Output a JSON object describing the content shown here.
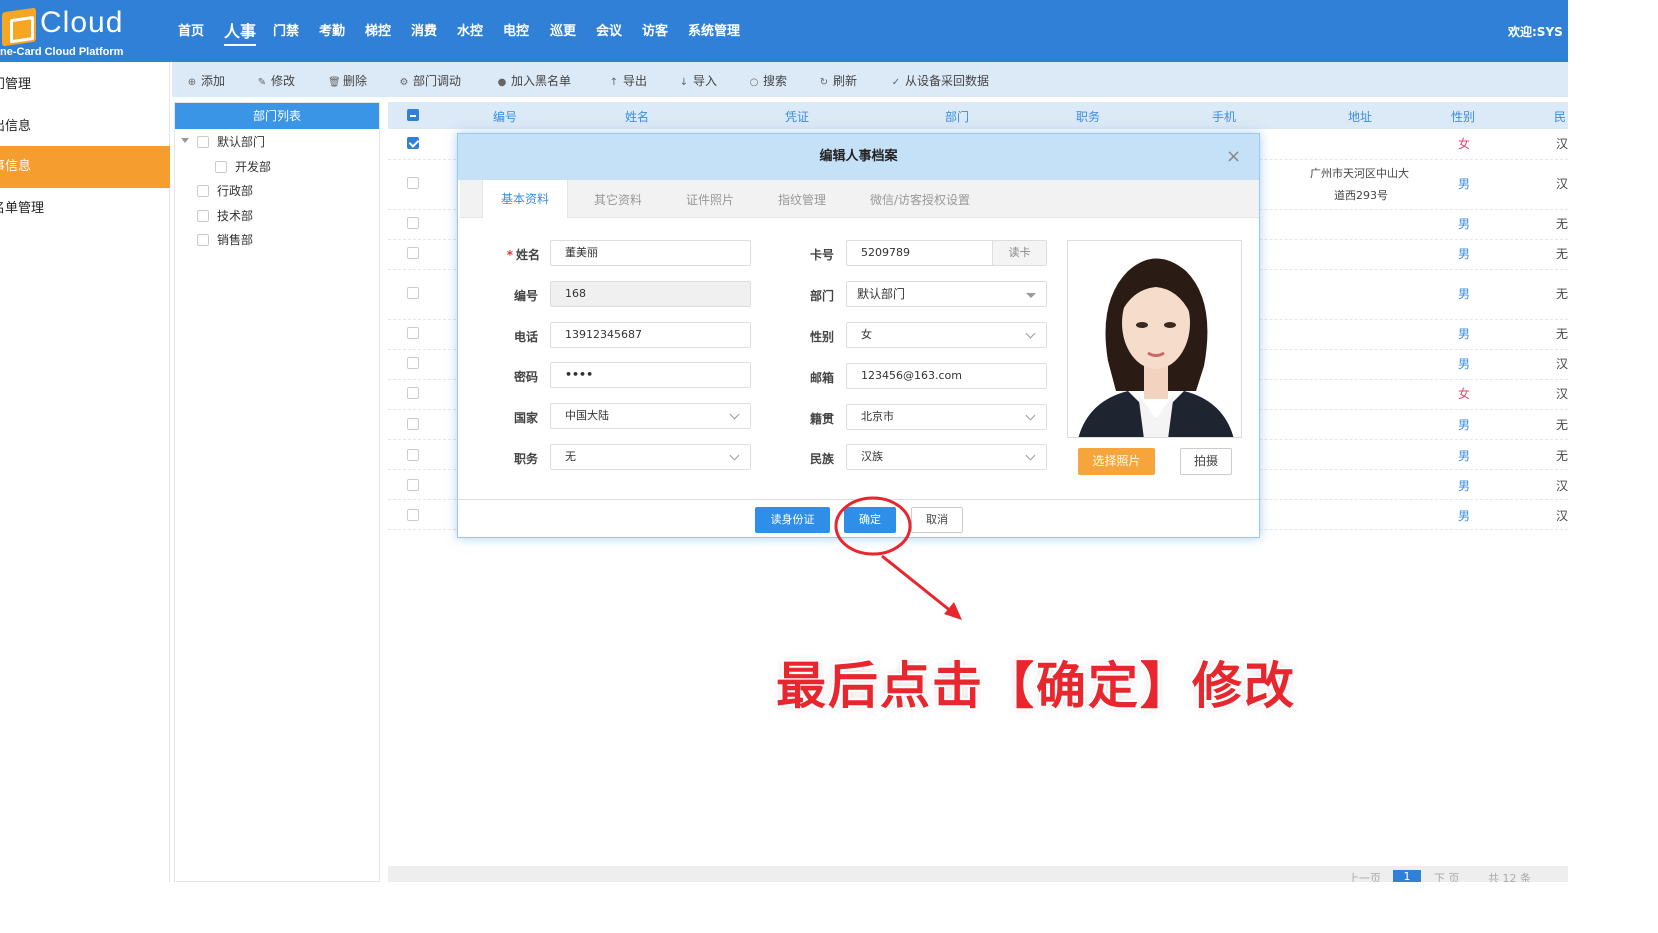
{
  "logo": {
    "name": "Cloud",
    "subtitle": "ne-Card Cloud Platform"
  },
  "nav": {
    "items": [
      "首页",
      "人事",
      "门禁",
      "考勤",
      "梯控",
      "消费",
      "水控",
      "电控",
      "巡更",
      "会议",
      "访客",
      "系统管理"
    ],
    "active": "人事"
  },
  "welcome": "欢迎:SYS",
  "sidebar": {
    "items": [
      "门管理",
      "出信息",
      "事信息",
      "名单管理"
    ],
    "active": "事信息"
  },
  "toolbar": {
    "buttons": [
      {
        "label": "添加",
        "icon": "plus-circle-icon"
      },
      {
        "label": "修改",
        "icon": "edit-icon"
      },
      {
        "label": "删除",
        "icon": "trash-icon"
      },
      {
        "label": "部门调动",
        "icon": "transfer-icon"
      },
      {
        "label": "加入黑名单",
        "icon": "blacklist-icon"
      },
      {
        "label": "导出",
        "icon": "export-icon"
      },
      {
        "label": "导入",
        "icon": "import-icon"
      },
      {
        "label": "搜索",
        "icon": "search-icon"
      },
      {
        "label": "刷新",
        "icon": "refresh-icon"
      },
      {
        "label": "从设备采回数据",
        "icon": "check-icon"
      }
    ]
  },
  "dept_panel": {
    "title": "部门列表",
    "tree": [
      {
        "label": "默认部门",
        "level": 0,
        "expanded": true
      },
      {
        "label": "开发部",
        "level": 1
      },
      {
        "label": "行政部",
        "level": 0
      },
      {
        "label": "技术部",
        "level": 0
      },
      {
        "label": "销售部",
        "level": 0
      }
    ]
  },
  "grid": {
    "columns": [
      "编号",
      "姓名",
      "凭证",
      "部门",
      "职务",
      "手机",
      "地址",
      "性别",
      "民"
    ],
    "rows": [
      {
        "checked": true,
        "address": "",
        "gender": "女",
        "ethnic": "汉"
      },
      {
        "checked": false,
        "address": "广州市天河区中山大道西293号",
        "gender": "男",
        "ethnic": "汉"
      },
      {
        "checked": false,
        "address": "",
        "gender": "男",
        "ethnic": "无"
      },
      {
        "checked": false,
        "address": "",
        "gender": "男",
        "ethnic": "无"
      },
      {
        "checked": false,
        "address": "",
        "gender": "男",
        "ethnic": "无"
      },
      {
        "checked": false,
        "address": "",
        "gender": "男",
        "ethnic": "无"
      },
      {
        "checked": false,
        "address": "",
        "gender": "男",
        "ethnic": "汉"
      },
      {
        "checked": false,
        "address": "",
        "gender": "女",
        "ethnic": "汉"
      },
      {
        "checked": false,
        "address": "",
        "gender": "男",
        "ethnic": "无"
      },
      {
        "checked": false,
        "address": "",
        "gender": "男",
        "ethnic": "无"
      },
      {
        "checked": false,
        "address": "",
        "gender": "男",
        "ethnic": "汉"
      },
      {
        "checked": false,
        "address": "",
        "gender": "男",
        "ethnic": "汉"
      }
    ],
    "address_line1": "广州市天河区中山大",
    "address_line2": "道西293号"
  },
  "pager": {
    "current": "1",
    "first": "上一页",
    "prev": "上 页",
    "next": "下 页",
    "last": "下一页",
    "total": "共 12 条",
    "page_size": "5"
  },
  "dialog": {
    "title": "编辑人事档案",
    "tabs": [
      "基本资料",
      "其它资料",
      "证件照片",
      "指纹管理",
      "微信/访客授权设置"
    ],
    "active_tab": "基本资料",
    "fields": {
      "name": {
        "label": "姓名",
        "value": "董美丽",
        "required": true
      },
      "number": {
        "label": "编号",
        "value": "168"
      },
      "phone": {
        "label": "电话",
        "value": "13912345687"
      },
      "password": {
        "label": "密码",
        "value": "••••"
      },
      "country": {
        "label": "国家",
        "value": "中国大陆"
      },
      "position": {
        "label": "职务",
        "value": "无"
      },
      "card": {
        "label": "卡号",
        "value": "5209789",
        "button": "读卡"
      },
      "dept": {
        "label": "部门",
        "value": "默认部门"
      },
      "gender": {
        "label": "性别",
        "value": "女"
      },
      "email": {
        "label": "邮箱",
        "value": "123456@163.com"
      },
      "hometown": {
        "label": "籍贯",
        "value": "北京市"
      },
      "ethnic": {
        "label": "民族",
        "value": "汉族"
      }
    },
    "photo_buttons": {
      "choose": "选择照片",
      "shoot": "拍摄"
    },
    "footer": {
      "read_id": "读身份证",
      "confirm": "确定",
      "cancel": "取消"
    }
  },
  "annotation": {
    "text": "最后点击【确定】修改",
    "color": "#e8262d"
  },
  "colors": {
    "topbar": "#2f80d6",
    "sidebar_active": "#f59d2e",
    "accent_blue": "#3b8ee0",
    "photo_button": "#f5a53b",
    "annotation_red": "#e8262d"
  }
}
